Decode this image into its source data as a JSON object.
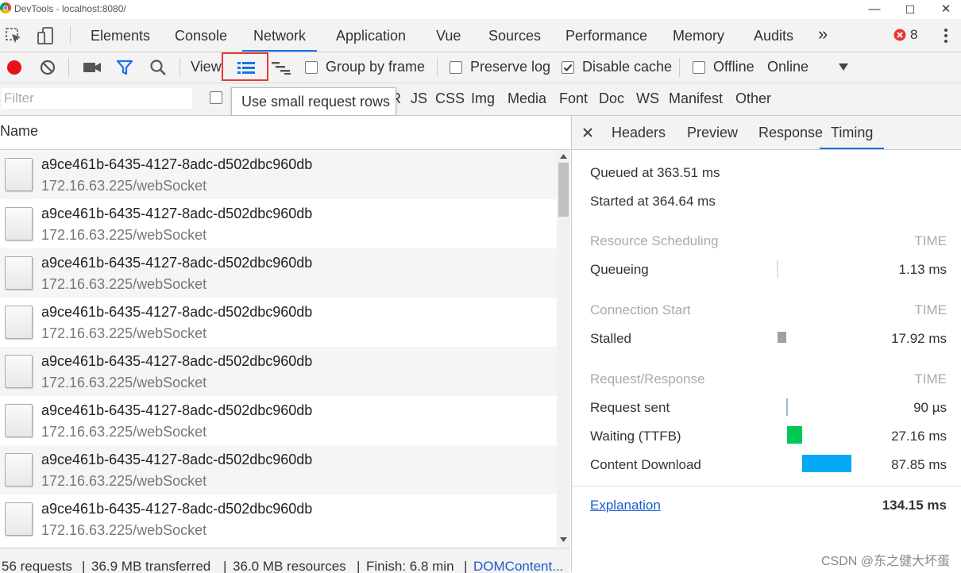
{
  "window": {
    "title": "DevTools - localhost:8080/",
    "min_glyph": "—",
    "max_glyph": "☐",
    "close_glyph": "✕"
  },
  "tabs": {
    "items": [
      "Elements",
      "Console",
      "Network",
      "Application",
      "Vue",
      "Sources",
      "Performance",
      "Memory",
      "Audits"
    ],
    "active": "Network",
    "more": "»",
    "error_count": "8",
    "error_icon": "error-icon"
  },
  "toolbar": {
    "view_label": "View",
    "group_by_frame": "Group by frame",
    "preserve_log": "Preserve log",
    "disable_cache": "Disable cache",
    "disable_cache_checked": true,
    "offline": "Offline",
    "throttle_value": "Online",
    "record_color": "#e8101b",
    "highlight_color": "#e53935"
  },
  "filterbar": {
    "placeholder": "Filter",
    "types": [
      "R",
      "JS",
      "CSS",
      "Img",
      "Media",
      "Font",
      "Doc",
      "WS",
      "Manifest",
      "Other"
    ],
    "tooltip": "Use small request rows"
  },
  "list": {
    "header": "Name",
    "rows": [
      {
        "name": "a9ce461b-6435-4127-8adc-d502dbc960db",
        "path": "172.16.63.225/webSocket"
      },
      {
        "name": "a9ce461b-6435-4127-8adc-d502dbc960db",
        "path": "172.16.63.225/webSocket"
      },
      {
        "name": "a9ce461b-6435-4127-8adc-d502dbc960db",
        "path": "172.16.63.225/webSocket"
      },
      {
        "name": "a9ce461b-6435-4127-8adc-d502dbc960db",
        "path": "172.16.63.225/webSocket"
      },
      {
        "name": "a9ce461b-6435-4127-8adc-d502dbc960db",
        "path": "172.16.63.225/webSocket"
      },
      {
        "name": "a9ce461b-6435-4127-8adc-d502dbc960db",
        "path": "172.16.63.225/webSocket"
      },
      {
        "name": "a9ce461b-6435-4127-8adc-d502dbc960db",
        "path": "172.16.63.225/webSocket"
      },
      {
        "name": "a9ce461b-6435-4127-8adc-d502dbc960db",
        "path": "172.16.63.225/webSocket"
      }
    ]
  },
  "details": {
    "tabs": [
      "Headers",
      "Preview",
      "Response",
      "Timing"
    ],
    "active_tab": "Timing",
    "queued": "Queued at 363.51 ms",
    "started": "Started at 364.64 ms",
    "time_label": "TIME",
    "sections": {
      "scheduling": "Resource Scheduling",
      "connection": "Connection Start",
      "request": "Request/Response"
    },
    "timings": {
      "queueing": {
        "label": "Queueing",
        "value": "1.13 ms"
      },
      "stalled": {
        "label": "Stalled",
        "value": "17.92 ms"
      },
      "sent": {
        "label": "Request sent",
        "value": "90 µs"
      },
      "waiting": {
        "label": "Waiting (TTFB)",
        "value": "27.16 ms",
        "color": "#00c853"
      },
      "download": {
        "label": "Content Download",
        "value": "87.85 ms",
        "color": "#03a9f4"
      }
    },
    "explanation": "Explanation",
    "total": "134.15 ms"
  },
  "status": {
    "requests": "56 requests",
    "transferred": "36.9 MB transferred",
    "resources": "36.0 MB resources",
    "finish": "Finish: 6.8 min",
    "domcontent": "DOMContent..."
  },
  "watermark": "CSDN @东之健大坏蛋"
}
